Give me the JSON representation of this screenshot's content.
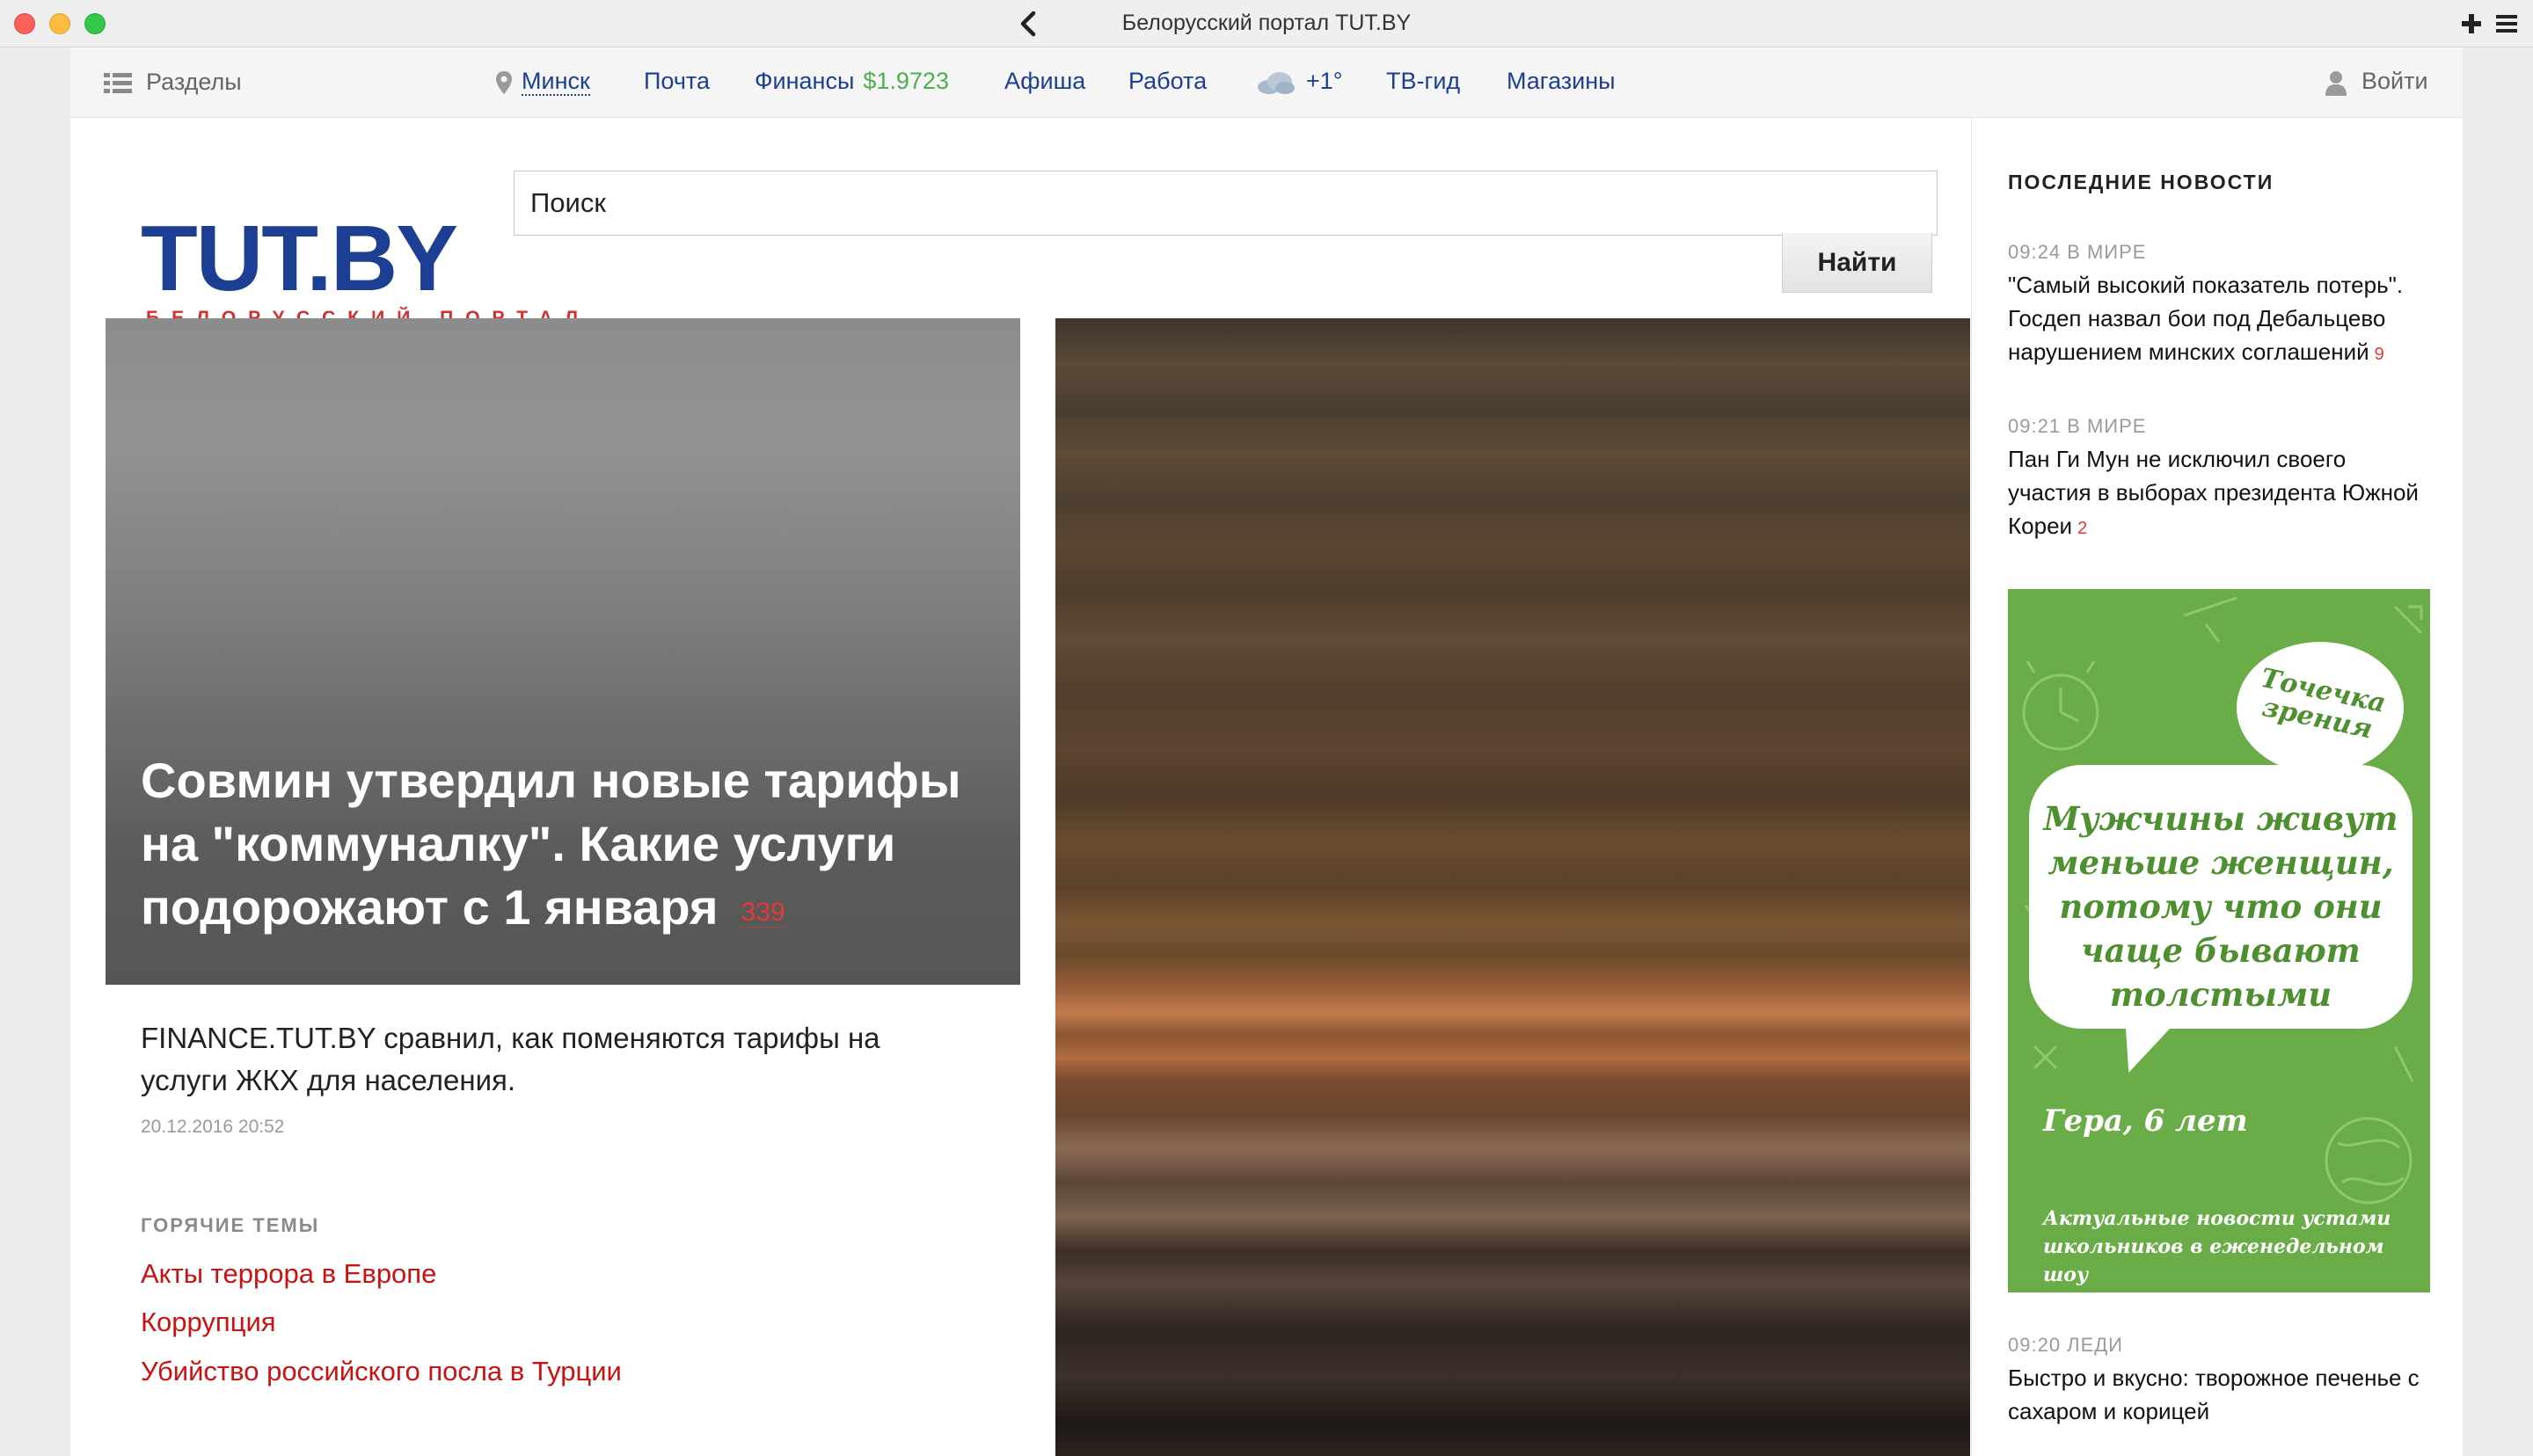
{
  "window": {
    "title": "Белорусский портал TUT.BY"
  },
  "nav": {
    "sections": "Разделы",
    "city": "Минск",
    "mail": "Почта",
    "finance": "Финансы",
    "finance_rate": "$1.9723",
    "afisha": "Афиша",
    "work": "Работа",
    "weather": "+1°",
    "tv": "ТВ-гид",
    "shops": "Магазины",
    "login": "Войти"
  },
  "logo": {
    "main": "TUT.BY",
    "sub": "БЕЛОРУССКИЙ ПОРТАЛ"
  },
  "search": {
    "placeholder": "Поиск",
    "button": "Найти"
  },
  "main_story": {
    "title": "Совмин утвердил новые тарифы на \"коммуналку\". Какие услуги подорожают с 1 января",
    "comments": "339",
    "lead": "FINANCE.TUT.BY сравнил, как поменяются тарифы на услуги ЖКХ для населения.",
    "date": "20.12.2016 20:52"
  },
  "hot_topics": {
    "title": "ГОРЯЧИЕ ТЕМЫ",
    "items": [
      "Акты террора в Европе",
      "Коррупция",
      "Убийство российского посла в Турции"
    ]
  },
  "latest": {
    "title": "ПОСЛЕДНИЕ НОВОСТИ",
    "items": [
      {
        "meta": "09:24 В МИРЕ",
        "text": "\"Самый высокий показатель потерь\". Госдеп назвал бои под Дебальцево нарушением минских соглашений",
        "count": "9"
      },
      {
        "meta": "09:21 В МИРЕ",
        "text": "Пан Ги Мун не исключил своего участия в выборах президента Южной Кореи",
        "count": "2"
      },
      {
        "meta": "09:20 ЛЕДИ",
        "text": "Быстро и вкусно: творожное печенье с сахаром и корицей",
        "count": ""
      }
    ]
  },
  "ad": {
    "badge": "Точечка зрения",
    "quote": "Мужчины живут меньше женщин, потому что они чаще бывают толстыми",
    "author": "Гера, 6 лет",
    "caption": "Актуальные новости устами школьников в еженедельном шоу"
  },
  "colors": {
    "brand_blue": "#1c3f94",
    "brand_red": "#d32f2f",
    "hot_link": "#cc1111",
    "rate_green": "#4caf50",
    "ad_green": "#6aac48"
  }
}
